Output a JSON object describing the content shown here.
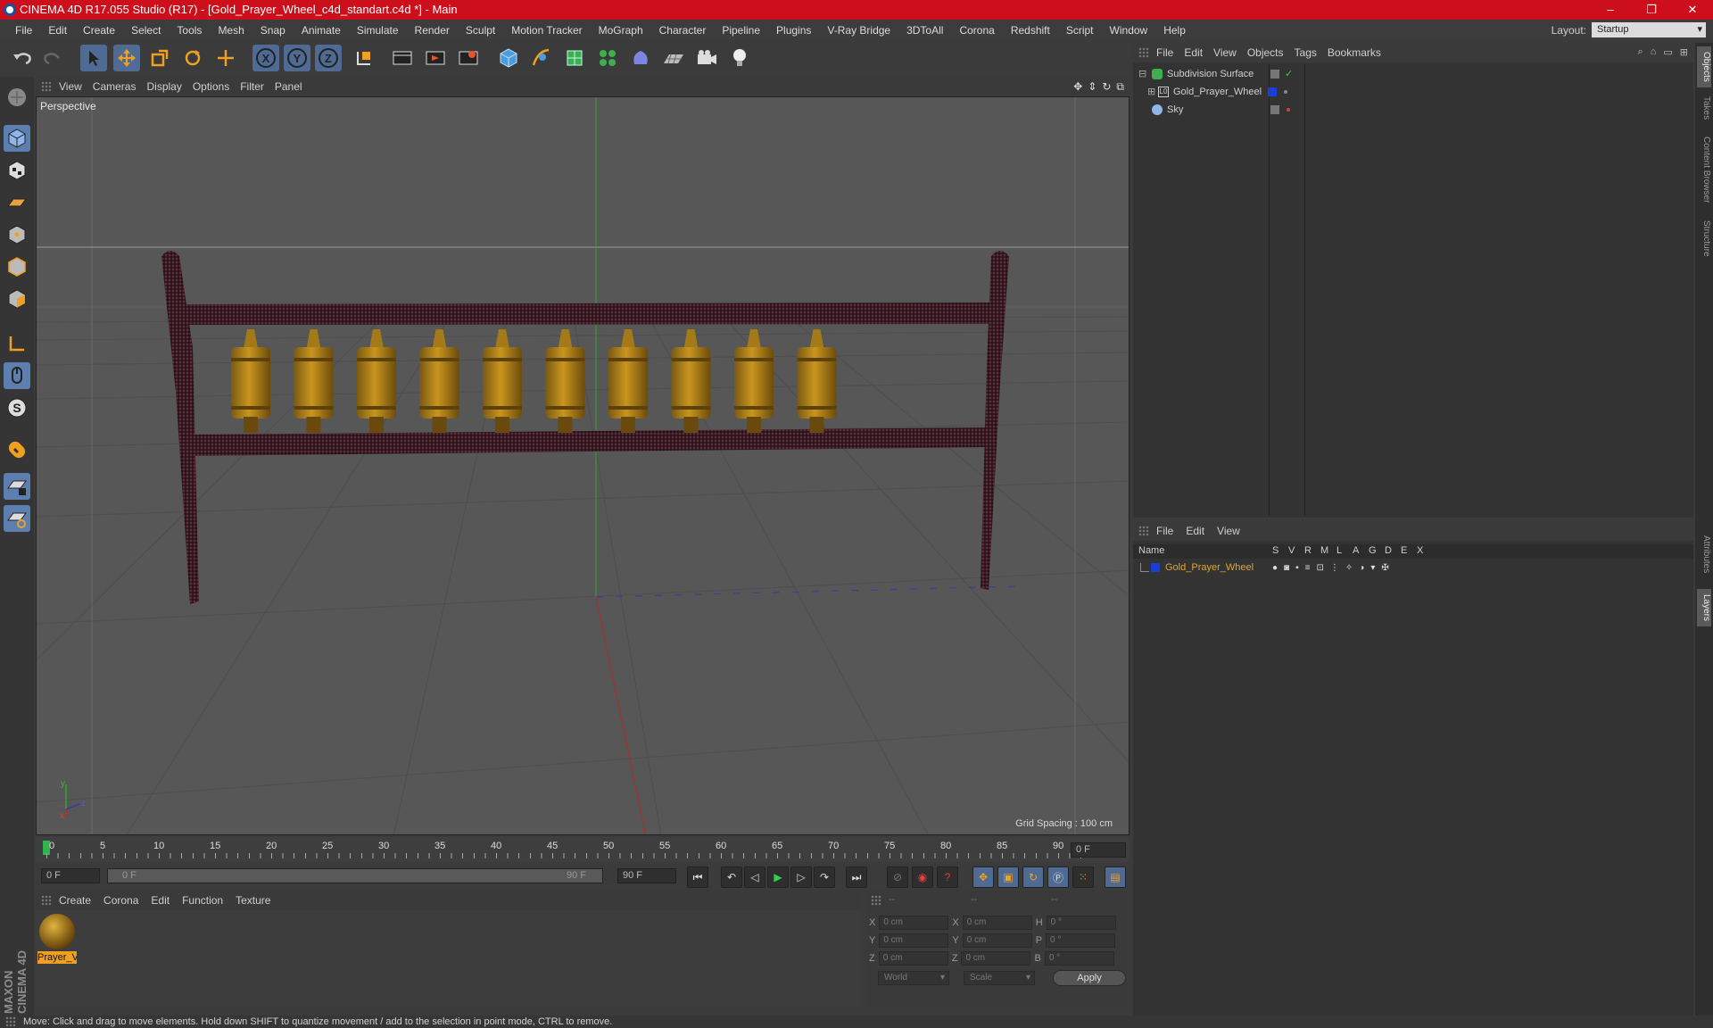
{
  "window": {
    "title": "CINEMA 4D R17.055 Studio (R17) - [Gold_Prayer_Wheel_c4d_standart.c4d *] - Main",
    "controls": [
      "–",
      "❐",
      "✕"
    ]
  },
  "menubar": {
    "items": [
      "File",
      "Edit",
      "Create",
      "Select",
      "Tools",
      "Mesh",
      "Snap",
      "Animate",
      "Simulate",
      "Render",
      "Sculpt",
      "Motion Tracker",
      "MoGraph",
      "Character",
      "Pipeline",
      "Plugins",
      "V-Ray Bridge",
      "3DToAll",
      "Corona",
      "Redshift",
      "Script",
      "Window",
      "Help"
    ],
    "layout_label": "Layout:",
    "layout_value": "Startup"
  },
  "viewport": {
    "menu": [
      "View",
      "Cameras",
      "Display",
      "Options",
      "Filter",
      "Panel"
    ],
    "camera_label": "Perspective",
    "grid_spacing": "Grid Spacing : 100 cm",
    "axis_labels": {
      "x": "x",
      "y": "y",
      "z": "z"
    }
  },
  "timeline": {
    "ticks": [
      "0",
      "5",
      "10",
      "15",
      "20",
      "25",
      "30",
      "35",
      "40",
      "45",
      "50",
      "55",
      "60",
      "65",
      "70",
      "75",
      "80",
      "85",
      "90"
    ],
    "current_frame": "0 F"
  },
  "transport": {
    "start_frame": "0 F",
    "slider_start": "0 F",
    "slider_end": "90 F",
    "end_frame": "90 F"
  },
  "material_manager": {
    "menu": [
      "Create",
      "Corona",
      "Edit",
      "Function",
      "Texture"
    ],
    "materials": [
      {
        "label": "Prayer_V"
      }
    ]
  },
  "coordinates": {
    "header": [
      "--",
      "--",
      "--"
    ],
    "rows": [
      {
        "a": "X",
        "av": "0 cm",
        "b": "X",
        "bv": "0 cm",
        "c": "H",
        "cv": "0 °"
      },
      {
        "a": "Y",
        "av": "0 cm",
        "b": "Y",
        "bv": "0 cm",
        "c": "P",
        "cv": "0 °"
      },
      {
        "a": "Z",
        "av": "0 cm",
        "b": "Z",
        "bv": "0 cm",
        "c": "B",
        "cv": "0 °"
      }
    ],
    "world": "World",
    "scale": "Scale",
    "apply": "Apply"
  },
  "object_manager": {
    "menu": [
      "File",
      "Edit",
      "View",
      "Objects",
      "Tags",
      "Bookmarks"
    ],
    "objects": [
      {
        "name": "Subdivision Surface",
        "icon": "subdivision-icon"
      },
      {
        "name": "Gold_Prayer_Wheel",
        "icon": "null-object-icon"
      },
      {
        "name": "Sky",
        "icon": "sky-icon"
      }
    ]
  },
  "layer_manager": {
    "menu": [
      "File",
      "Edit",
      "View"
    ],
    "columns": [
      "Name",
      "S",
      "V",
      "R",
      "M",
      "L",
      "A",
      "G",
      "D",
      "E",
      "X"
    ],
    "layers": [
      {
        "name": "Gold_Prayer_Wheel",
        "color": "#1b3fd6"
      }
    ]
  },
  "side_tabs": [
    "Objects",
    "Takes",
    "Content Browser",
    "Structure",
    "Attributes",
    "Layers"
  ],
  "branding": "MAXON CINEMA 4D",
  "status": "Move: Click and drag to move elements. Hold down SHIFT to quantize movement / add to the selection in point mode, CTRL to remove.",
  "colors": {
    "titlebar": "#cd0e1b",
    "accent_blue": "#4f6a93",
    "layer_orange": "#e8a422"
  }
}
